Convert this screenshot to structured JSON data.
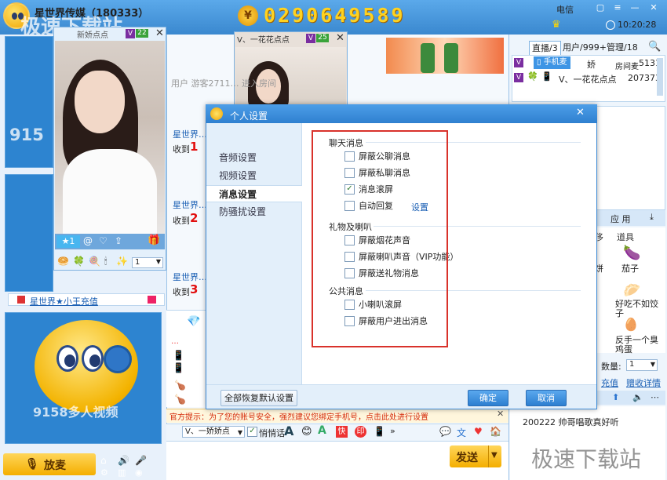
{
  "window": {
    "title": "星世界传媒（180333）",
    "coins": "0290649589",
    "carrier": "电信",
    "clock": "10:20:28"
  },
  "watermark": {
    "top": "极速下载站",
    "bottom": "极速下载站"
  },
  "left": {
    "tile1_label": "915",
    "tile3_label": "9158多人视频",
    "room_link": "星世界★小王充值",
    "mic_button": "放麦",
    "popup_title": "新娇点点",
    "popup_badge": "22",
    "popup_star_count": "★1",
    "popup_select_value": "1"
  },
  "middle": {
    "video2_title": "V、一花花点点",
    "video2_badge": "25",
    "chat_lines": [
      {
        "user": "星世界…",
        "text": "收到",
        "num": "1"
      },
      {
        "user": "星世界…",
        "text": "收到",
        "num": "2"
      },
      {
        "user": "星世界…",
        "text": "收到",
        "num": "3"
      }
    ],
    "system_line": "用户 游客2711… 进入房间",
    "notice": "官方提示：为了您的账号安全，强烈建议您绑定手机号，点击此处进行设置",
    "chat_target": "V、一娇娇点",
    "whisper_label": "悄悄话",
    "send_button": "发送"
  },
  "right": {
    "tabs": [
      "直播/3",
      "用户/999+",
      "管理/18"
    ],
    "users": [
      {
        "name": "娇",
        "extra": "5131",
        "tag": "手机麦",
        "room": "房间麦"
      },
      {
        "name": "V、一花花点点",
        "extra": "207373"
      }
    ],
    "app_header": "应 用",
    "app_items": [
      "饼",
      "茄子",
      "好吃不如饺子",
      "反手一个臭鸡蛋"
    ],
    "amount_label": "数量:",
    "amount_value": "1",
    "recharge_label": "充值",
    "gift_detail_label": "赠收详情",
    "bottom_line": "200222 帅哥唱歌真好听"
  },
  "dialog": {
    "title": "个人设置",
    "nav": [
      "音频设置",
      "视频设置",
      "消息设置",
      "防骚扰设置"
    ],
    "active_nav": "消息设置",
    "groups": [
      {
        "title": "聊天消息",
        "items": [
          {
            "label": "屏蔽公聊消息",
            "checked": false
          },
          {
            "label": "屏蔽私聊消息",
            "checked": false
          },
          {
            "label": "消息滚屏",
            "checked": true
          },
          {
            "label": "自动回复",
            "checked": false,
            "link": "设置"
          }
        ]
      },
      {
        "title": "礼物及喇叭",
        "items": [
          {
            "label": "屏蔽烟花声音",
            "checked": false
          },
          {
            "label": "屏蔽喇叭声音（VIP功能）",
            "checked": false
          },
          {
            "label": "屏蔽送礼物消息",
            "checked": false
          }
        ]
      },
      {
        "title": "公共消息",
        "items": [
          {
            "label": "小喇叭滚屏",
            "checked": false
          },
          {
            "label": "屏蔽用户进出消息",
            "checked": false
          }
        ]
      }
    ],
    "restore_button": "全部恢复默认设置",
    "ok_button": "确定",
    "cancel_button": "取消"
  }
}
